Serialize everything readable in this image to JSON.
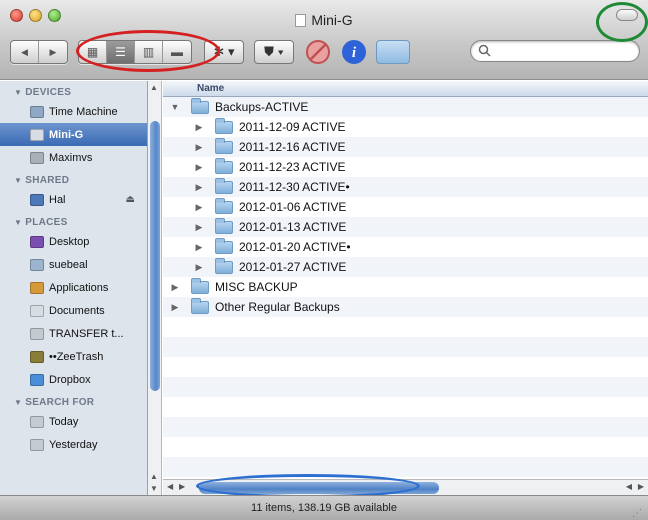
{
  "window": {
    "title": "Mini-G",
    "colors": {
      "selection": "#3a6bb6",
      "sidebar_bg": "#dde4ec",
      "annotation_red": "#d42020",
      "annotation_green": "#1f8a35",
      "annotation_blue": "#2d6fd1"
    }
  },
  "toolbar": {
    "nav": [
      {
        "icon": "back-arrow-icon",
        "glyph": "◀"
      },
      {
        "icon": "forward-arrow-icon",
        "glyph": "▶"
      }
    ],
    "view_modes": [
      {
        "name": "icon-view",
        "glyph": "▦"
      },
      {
        "name": "list-view",
        "glyph": "☰",
        "selected": true
      },
      {
        "name": "column-view",
        "glyph": "▥"
      },
      {
        "name": "coverflow-view",
        "glyph": "▬"
      }
    ],
    "action_glyph": "✲ ▾",
    "dropbox_glyph": "⛊ ▾",
    "search_placeholder": ""
  },
  "sidebar": {
    "sections": [
      {
        "heading": "DEVICES",
        "items": [
          {
            "label": "Time Machine",
            "icon": "time-machine-icon",
            "color": "#8fa8c4"
          },
          {
            "label": "Mini-G",
            "icon": "drive-icon",
            "color": "#d8dde4",
            "selected": true
          },
          {
            "label": "Maximvs",
            "icon": "drive-icon",
            "color": "#a9b0b8"
          }
        ]
      },
      {
        "heading": "SHARED",
        "items": [
          {
            "label": "Hal",
            "icon": "computer-icon",
            "color": "#4d79b8",
            "eject": "⏏"
          }
        ]
      },
      {
        "heading": "PLACES",
        "items": [
          {
            "label": "Desktop",
            "icon": "desktop-icon",
            "color": "#7a4fb0"
          },
          {
            "label": "suebeal",
            "icon": "home-icon",
            "color": "#9db4cf"
          },
          {
            "label": "Applications",
            "icon": "applications-icon",
            "color": "#d49a3a"
          },
          {
            "label": "Documents",
            "icon": "documents-icon",
            "color": "#d8dde4"
          },
          {
            "label": "TRANSFER t...",
            "icon": "folder-icon",
            "color": "#c5cad1"
          },
          {
            "label": "••ZeeTrash",
            "icon": "trash-folder-icon",
            "color": "#8a7d3a"
          },
          {
            "label": "Dropbox",
            "icon": "dropbox-icon",
            "color": "#4a90d9"
          }
        ]
      },
      {
        "heading": "SEARCH FOR",
        "items": [
          {
            "label": "Today",
            "icon": "clock-icon",
            "color": "#c4cbd3"
          },
          {
            "label": "Yesterday",
            "icon": "clock-icon",
            "color": "#c4cbd3"
          }
        ]
      }
    ]
  },
  "list": {
    "header": "Name",
    "rows": [
      {
        "name": "Backups-ACTIVE",
        "level": 0,
        "expanded": true
      },
      {
        "name": "2011-12-09 ACTIVE",
        "level": 1
      },
      {
        "name": "2011-12-16 ACTIVE",
        "level": 1
      },
      {
        "name": "2011-12-23 ACTIVE",
        "level": 1
      },
      {
        "name": "2011-12-30 ACTIVE•",
        "level": 1
      },
      {
        "name": "2012-01-06 ACTIVE",
        "level": 1
      },
      {
        "name": "2012-01-13 ACTIVE",
        "level": 1
      },
      {
        "name": "2012-01-20 ACTIVE•",
        "level": 1
      },
      {
        "name": "2012-01-27 ACTIVE",
        "level": 1
      },
      {
        "name": "MISC BACKUP",
        "level": 0
      },
      {
        "name": "Other Regular Backups",
        "level": 0
      }
    ]
  },
  "status": {
    "text": "11 items, 138.19 GB available"
  }
}
